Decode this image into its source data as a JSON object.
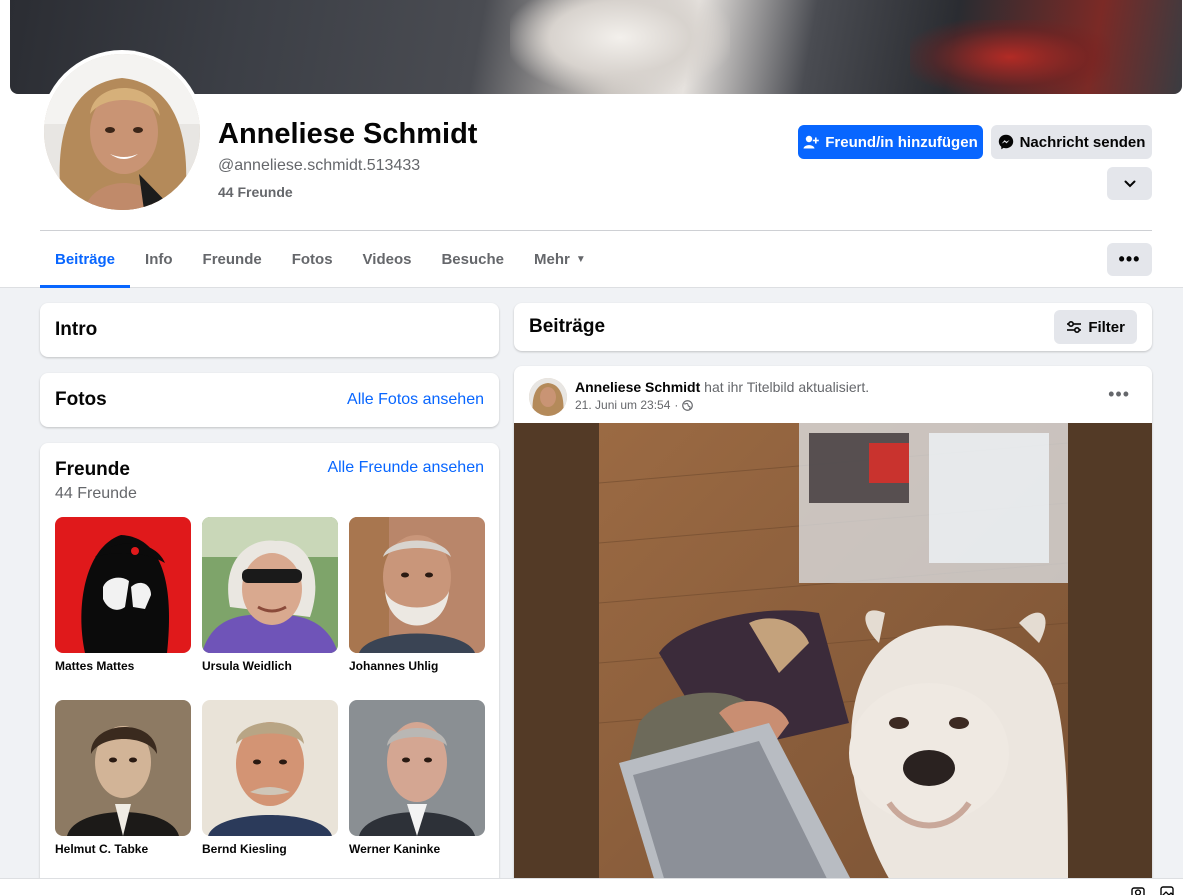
{
  "profile": {
    "name": "Anneliese Schmidt",
    "username": "@anneliese.schmidt.513433",
    "friends_count": "44 Freunde"
  },
  "actions": {
    "add_friend": "Freund/in hinzufügen",
    "send_message": "Nachricht senden"
  },
  "tabs": [
    {
      "label": "Beiträge"
    },
    {
      "label": "Info"
    },
    {
      "label": "Freunde"
    },
    {
      "label": "Fotos"
    },
    {
      "label": "Videos"
    },
    {
      "label": "Besuche"
    },
    {
      "label": "Mehr"
    }
  ],
  "intro": {
    "title": "Intro"
  },
  "photos": {
    "title": "Fotos",
    "see_all": "Alle Fotos ansehen"
  },
  "friends": {
    "title": "Freunde",
    "see_all": "Alle Freunde ansehen",
    "count": "44 Freunde",
    "items": [
      {
        "name": "Mattes Mattes"
      },
      {
        "name": "Ursula Weidlich"
      },
      {
        "name": "Johannes Uhlig"
      },
      {
        "name": "Helmut C. Tabke"
      },
      {
        "name": "Bernd Kiesling"
      },
      {
        "name": "Werner Kaninke"
      }
    ]
  },
  "posts": {
    "title": "Beiträge",
    "filter_label": "Filter"
  },
  "post": {
    "author": "Anneliese Schmidt",
    "action": "hat ihr Titelbild aktualisiert.",
    "date": "21. Juni um 23:54"
  },
  "colors": {
    "accent": "#0866ff",
    "secondary_button": "#e4e6eb",
    "muted_text": "#65676b",
    "page_bg": "#f0f2f5"
  }
}
